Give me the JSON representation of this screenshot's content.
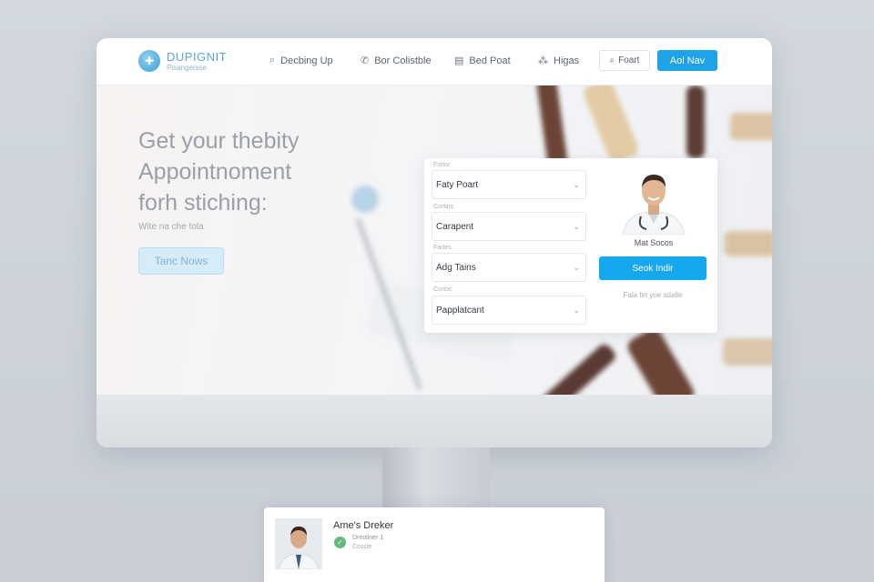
{
  "nav": {
    "logo_name": "DUPIGNIT",
    "logo_sub": "Pisangersse",
    "items": [
      {
        "label": "Decbing Up",
        "icon": "search-icon"
      },
      {
        "label": "Bor Colistble",
        "icon": "phone-icon"
      },
      {
        "label": "Bed Poat",
        "icon": "calendar-icon"
      },
      {
        "label": "Higas",
        "icon": "network-icon"
      }
    ],
    "find_label": "Foart",
    "add_label": "Aol Nav"
  },
  "hero": {
    "title_lines": [
      "Get your thebity",
      "Appointnoment",
      "forh stiching:"
    ],
    "subtitle": "Wite na che tola",
    "cta_label": "Tanc Nows"
  },
  "booking": {
    "fields": [
      {
        "label": "Fsrtor",
        "value": "Faty Poart"
      },
      {
        "label": "Cortins",
        "value": "Carapent"
      },
      {
        "label": "Fartes",
        "value": "Adg Tains"
      },
      {
        "label": "Cortoc",
        "value": "Papplatcant"
      }
    ],
    "doctor_name": "Mat Socos",
    "book_label": "Seok Indir",
    "note": "Fala fet yoe sdalle"
  },
  "notification": {
    "title": "Ame's Dreker",
    "line1": "Dreoliner  1",
    "line2": "Coscle"
  },
  "colors": {
    "accent": "#1ea2e8",
    "check": "#63b87a",
    "hero_text": "#9aa0a8"
  }
}
